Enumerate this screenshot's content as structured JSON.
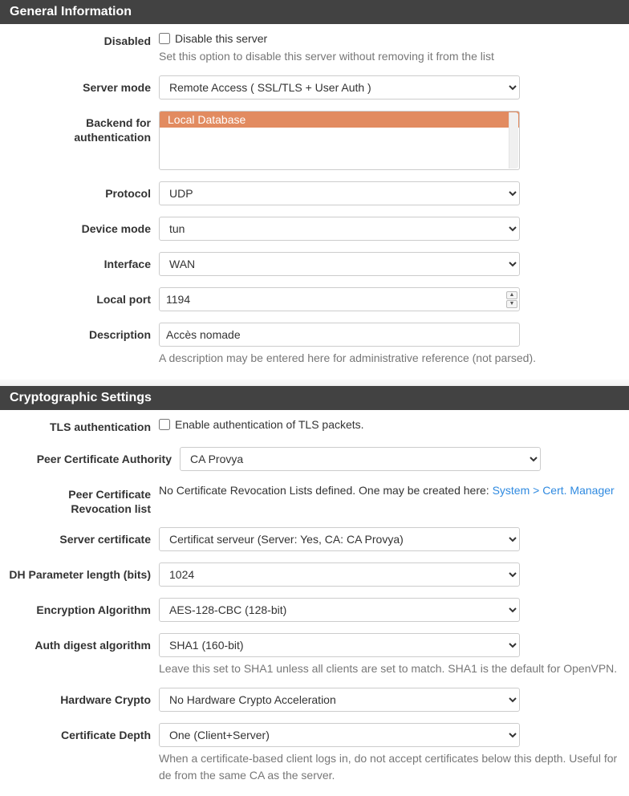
{
  "general": {
    "heading": "General Information",
    "disabled": {
      "label": "Disabled",
      "checkbox_label": "Disable this server",
      "help": "Set this option to disable this server without removing it from the list"
    },
    "server_mode": {
      "label": "Server mode",
      "value": "Remote Access ( SSL/TLS + User Auth )"
    },
    "backend_auth": {
      "label": "Backend for authentication",
      "selected": "Local Database"
    },
    "protocol": {
      "label": "Protocol",
      "value": "UDP"
    },
    "device_mode": {
      "label": "Device mode",
      "value": "tun"
    },
    "interface": {
      "label": "Interface",
      "value": "WAN"
    },
    "local_port": {
      "label": "Local port",
      "value": "1194"
    },
    "description": {
      "label": "Description",
      "value": "Accès nomade",
      "help": "A description may be entered here for administrative reference (not parsed)."
    }
  },
  "crypto": {
    "heading": "Cryptographic Settings",
    "tls_auth": {
      "label": "TLS authentication",
      "checkbox_label": "Enable authentication of TLS packets."
    },
    "peer_ca": {
      "label": "Peer Certificate Authority",
      "value": "CA Provya"
    },
    "peer_crl": {
      "label": "Peer Certificate Revocation list",
      "text_before": "No Certificate Revocation Lists defined. One may be created here: ",
      "link": "System > Cert. Manager"
    },
    "server_cert": {
      "label": "Server certificate",
      "value": "Certificat serveur (Server: Yes, CA: CA Provya)"
    },
    "dh_len": {
      "label": "DH Parameter length (bits)",
      "value": "1024"
    },
    "enc_algo": {
      "label": "Encryption Algorithm",
      "value": "AES-128-CBC (128-bit)"
    },
    "auth_digest": {
      "label": "Auth digest algorithm",
      "value": "SHA1 (160-bit)",
      "help": "Leave this set to SHA1 unless all clients are set to match. SHA1 is the default for OpenVPN."
    },
    "hw_crypto": {
      "label": "Hardware Crypto",
      "value": "No Hardware Crypto Acceleration"
    },
    "cert_depth": {
      "label": "Certificate Depth",
      "value": "One (Client+Server)",
      "help": "When a certificate-based client logs in, do not accept certificates below this depth. Useful for de from the same CA as the server."
    }
  }
}
